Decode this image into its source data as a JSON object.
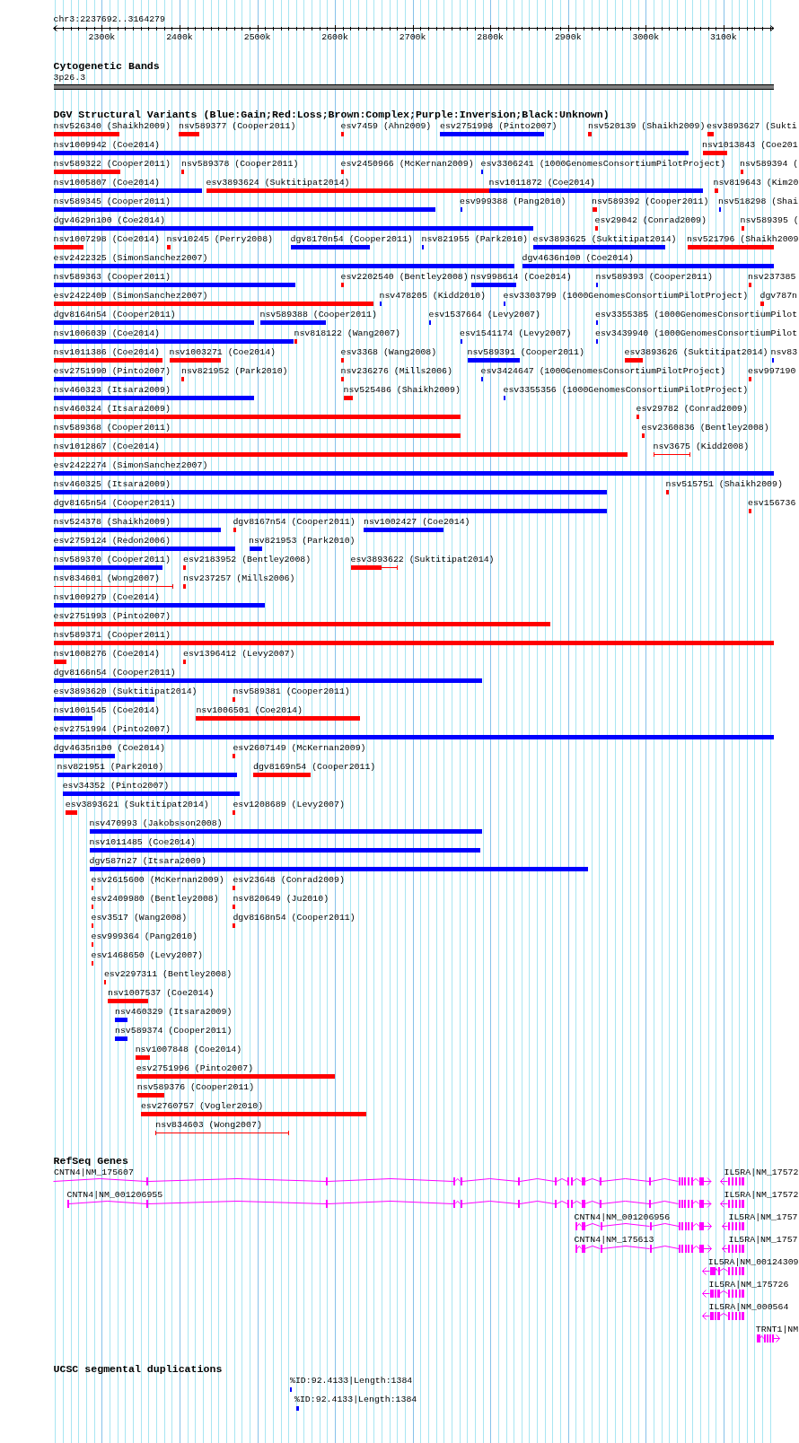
{
  "ruler": {
    "location": "chr3:2237692..3164279",
    "ticks": [
      "2300k",
      "2400k",
      "2500k",
      "2600k",
      "2700k",
      "2800k",
      "2900k",
      "3000k",
      "3100k"
    ]
  },
  "cytogenetic_bands": {
    "title": "Cytogenetic Bands",
    "band": "3p26.3"
  },
  "dgv_structural_variants": {
    "title": "DGV Structural Variants (Blue:Gain;Red:Loss;Brown:Complex;Purple:Inversion;Black:Unknown)",
    "rows": [
      {
        "variants": [
          {
            "label": "nsv526340 (Shaikh2009)",
            "color": "#ff0000"
          },
          {
            "label": "nsv589377 (Cooper2011)",
            "color": "#ff0000"
          },
          {
            "label": "esv7459 (Ahn2009)",
            "color": "#ff0000"
          },
          {
            "label": "esv2751998 (Pinto2007)",
            "color": "#0000ff"
          },
          {
            "label": "nsv520139 (Shaikh2009)",
            "color": "#ff0000"
          },
          {
            "label": "esv3893627 (Sukti",
            "color": "#ff0000"
          }
        ]
      },
      {
        "variants": [
          {
            "label": "nsv1009942 (Coe2014)",
            "color": "#0000ff"
          },
          {
            "label": "nsv1013843 (Coe201",
            "color": "#ff0000"
          }
        ]
      },
      {
        "variants": [
          {
            "label": "nsv589322 (Cooper2011)",
            "color": "#ff0000"
          },
          {
            "label": "nsv589378 (Cooper2011)",
            "color": "#ff0000"
          },
          {
            "label": "esv2450966 (McKernan2009)",
            "color": "#ff0000"
          },
          {
            "label": "esv3306241 (1000GenomesConsortiumPilotProject)",
            "color": "#0000ff"
          },
          {
            "label": "nsv589394 (",
            "color": "#ff0000"
          }
        ]
      },
      {
        "variants": [
          {
            "label": "nsv1005807 (Coe2014)",
            "color": "#0000ff"
          },
          {
            "label": "esv3893624 (Suktitipat2014)",
            "color": "#ff0000"
          },
          {
            "label": "nsv1011872 (Coe2014)",
            "color": "#0000ff"
          },
          {
            "label": "nsv819643 (Kim20",
            "color": "#ff0000"
          }
        ]
      },
      {
        "variants": [
          {
            "label": "nsv589345 (Cooper2011)",
            "color": "#0000ff"
          },
          {
            "label": "esv999388 (Pang2010)",
            "color": "#0000ff"
          },
          {
            "label": "nsv589392 (Cooper2011)",
            "color": "#ff0000"
          },
          {
            "label": "nsv518298 (Shai",
            "color": "#0000ff"
          }
        ]
      },
      {
        "variants": [
          {
            "label": "dgv4629n100 (Coe2014)",
            "color": "#0000ff"
          },
          {
            "label": "esv29042 (Conrad2009)",
            "color": "#ff0000"
          },
          {
            "label": "nsv589395 (",
            "color": "#ff0000"
          }
        ]
      },
      {
        "variants": [
          {
            "label": "nsv1007298 (Coe2014)",
            "color": "#ff0000"
          },
          {
            "label": "nsv10245 (Perry2008)",
            "color": "#ff0000"
          },
          {
            "label": "dgv8170n54 (Cooper2011)",
            "color": "#0000ff"
          },
          {
            "label": "nsv821955 (Park2010)",
            "color": "#0000ff"
          },
          {
            "label": "esv3893625 (Suktitipat2014)",
            "color": "#0000ff"
          },
          {
            "label": "nsv521796 (Shaikh2009",
            "color": "#ff0000"
          }
        ]
      },
      {
        "variants": [
          {
            "label": "esv2422325 (SimonSanchez2007)",
            "color": "#0000ff"
          },
          {
            "label": "dgv4636n100 (Coe2014)",
            "color": "#0000ff"
          }
        ]
      },
      {
        "variants": [
          {
            "label": "nsv589363 (Cooper2011)",
            "color": "#0000ff"
          },
          {
            "label": "esv2202540 (Bentley2008)",
            "color": "#ff0000"
          },
          {
            "label": "nsv998614 (Coe2014)",
            "color": "#0000ff"
          },
          {
            "label": "nsv589393 (Cooper2011)",
            "color": "#0000ff"
          },
          {
            "label": "nsv237385",
            "color": "#ff0000"
          }
        ]
      },
      {
        "variants": [
          {
            "label": "esv2422409 (SimonSanchez2007)",
            "color": "#ff0000"
          },
          {
            "label": "nsv478205 (Kidd2010)",
            "color": "#0000ff"
          },
          {
            "label": "esv3303799 (1000GenomesConsortiumPilotProject)",
            "color": "#0000ff"
          },
          {
            "label": "dgv787n",
            "color": "#ff0000"
          }
        ]
      },
      {
        "variants": [
          {
            "label": "dgv8164n54 (Cooper2011)",
            "color": "#0000ff"
          },
          {
            "label": "nsv589388 (Cooper2011)",
            "color": "#0000ff"
          },
          {
            "label": "esv1537664 (Levy2007)",
            "color": "#0000ff"
          },
          {
            "label": "esv3355385 (1000GenomesConsortiumPilot",
            "color": "#0000ff"
          }
        ]
      },
      {
        "variants": [
          {
            "label": "nsv1006039 (Coe2014)",
            "color": "#0000ff"
          },
          {
            "label": "nsv818122 (Wang2007)",
            "color": "#ff0000"
          },
          {
            "label": "esv1541174 (Levy2007)",
            "color": "#0000ff"
          },
          {
            "label": "esv3439940 (1000GenomesConsortiumPilot",
            "color": "#0000ff"
          }
        ]
      },
      {
        "variants": [
          {
            "label": "nsv1011386 (Coe2014)",
            "color": "#ff0000"
          },
          {
            "label": "nsv1003271 (Coe2014)",
            "color": "#ff0000"
          },
          {
            "label": "esv3368 (Wang2008)",
            "color": "#ff0000"
          },
          {
            "label": "nsv589391 (Cooper2011)",
            "color": "#0000ff"
          },
          {
            "label": "esv3893626 (Suktitipat2014)",
            "color": "#ff0000"
          },
          {
            "label": "nsv83",
            "color": "#0000ff"
          }
        ]
      },
      {
        "variants": [
          {
            "label": "esv2751990 (Pinto2007)",
            "color": "#0000ff"
          },
          {
            "label": "nsv821952 (Park2010)",
            "color": "#ff0000"
          },
          {
            "label": "nsv236276 (Mills2006)",
            "color": "#ff0000"
          },
          {
            "label": "esv3424647 (1000GenomesConsortiumPilotProject)",
            "color": "#0000ff"
          },
          {
            "label": "esv997190",
            "color": "#ff0000"
          }
        ]
      },
      {
        "variants": [
          {
            "label": "nsv460323 (Itsara2009)",
            "color": "#0000ff"
          },
          {
            "label": "nsv525486 (Shaikh2009)",
            "color": "#ff0000"
          },
          {
            "label": "esv3355356 (1000GenomesConsortiumPilotProject)",
            "color": "#0000ff"
          }
        ]
      },
      {
        "variants": [
          {
            "label": "nsv460324 (Itsara2009)",
            "color": "#ff0000"
          },
          {
            "label": "esv29782 (Conrad2009)",
            "color": "#ff0000"
          }
        ]
      },
      {
        "variants": [
          {
            "label": "nsv589368 (Cooper2011)",
            "color": "#ff0000"
          },
          {
            "label": "esv2360836 (Bentley2008)",
            "color": "#ff0000"
          }
        ]
      },
      {
        "variants": [
          {
            "label": "nsv1012867 (Coe2014)",
            "color": "#ff0000"
          },
          {
            "label": "nsv3675 (Kidd2008)",
            "color": "#ff0000"
          }
        ]
      },
      {
        "variants": [
          {
            "label": "esv2422274 (SimonSanchez2007)",
            "color": "#0000ff"
          }
        ]
      },
      {
        "variants": [
          {
            "label": "nsv460325 (Itsara2009)",
            "color": "#0000ff"
          },
          {
            "label": "nsv515751 (Shaikh2009)",
            "color": "#ff0000"
          }
        ]
      },
      {
        "variants": [
          {
            "label": "dgv8165n54 (Cooper2011)",
            "color": "#0000ff"
          },
          {
            "label": "esv156736",
            "color": "#ff0000"
          }
        ]
      },
      {
        "variants": [
          {
            "label": "nsv524378 (Shaikh2009)",
            "color": "#0000ff"
          },
          {
            "label": "dgv8167n54 (Cooper2011)",
            "color": "#ff0000"
          },
          {
            "label": "nsv1002427 (Coe2014)",
            "color": "#0000ff"
          }
        ]
      },
      {
        "variants": [
          {
            "label": "esv2759124 (Redon2006)",
            "color": "#0000ff"
          },
          {
            "label": "nsv821953 (Park2010)",
            "color": "#0000ff"
          }
        ]
      },
      {
        "variants": [
          {
            "label": "nsv589370 (Cooper2011)",
            "color": "#0000ff"
          },
          {
            "label": "esv2183952 (Bentley2008)",
            "color": "#ff0000"
          },
          {
            "label": "esv3893622 (Suktitipat2014)",
            "color": "#ff0000"
          }
        ]
      },
      {
        "variants": [
          {
            "label": "nsv834601 (Wong2007)",
            "color": "#ff0000"
          },
          {
            "label": "nsv237257 (Mills2006)",
            "color": "#ff0000"
          }
        ]
      },
      {
        "variants": [
          {
            "label": "nsv1009279 (Coe2014)",
            "color": "#0000ff"
          }
        ]
      },
      {
        "variants": [
          {
            "label": "esv2751993 (Pinto2007)",
            "color": "#ff0000"
          }
        ]
      },
      {
        "variants": [
          {
            "label": "nsv589371 (Cooper2011)",
            "color": "#ff0000"
          }
        ]
      },
      {
        "variants": [
          {
            "label": "nsv1008276 (Coe2014)",
            "color": "#ff0000"
          },
          {
            "label": "esv1396412 (Levy2007)",
            "color": "#ff0000"
          }
        ]
      },
      {
        "variants": [
          {
            "label": "dgv8166n54 (Cooper2011)",
            "color": "#0000ff"
          }
        ]
      },
      {
        "variants": [
          {
            "label": "esv3893620 (Suktitipat2014)",
            "color": "#0000ff"
          },
          {
            "label": "nsv589381 (Cooper2011)",
            "color": "#ff0000"
          }
        ]
      },
      {
        "variants": [
          {
            "label": "nsv1001545 (Coe2014)",
            "color": "#0000ff"
          },
          {
            "label": "nsv1006501 (Coe2014)",
            "color": "#ff0000"
          }
        ]
      },
      {
        "variants": [
          {
            "label": "esv2751994 (Pinto2007)",
            "color": "#0000ff"
          }
        ]
      },
      {
        "variants": [
          {
            "label": "dgv4635n100 (Coe2014)",
            "color": "#0000ff"
          },
          {
            "label": "esv2607149 (McKernan2009)",
            "color": "#ff0000"
          }
        ]
      },
      {
        "variants": [
          {
            "label": "nsv821951 (Park2010)",
            "color": "#0000ff"
          },
          {
            "label": "dgv8169n54 (Cooper2011)",
            "color": "#ff0000"
          }
        ]
      },
      {
        "variants": [
          {
            "label": "esv34352 (Pinto2007)",
            "color": "#0000ff"
          }
        ]
      },
      {
        "variants": [
          {
            "label": "esv3893621 (Suktitipat2014)",
            "color": "#ff0000"
          },
          {
            "label": "esv1208689 (Levy2007)",
            "color": "#ff0000"
          }
        ]
      },
      {
        "variants": [
          {
            "label": "nsv470993 (Jakobsson2008)",
            "color": "#0000ff"
          }
        ]
      },
      {
        "variants": [
          {
            "label": "nsv1011485 (Coe2014)",
            "color": "#0000ff"
          }
        ]
      },
      {
        "variants": [
          {
            "label": "dgv587n27 (Itsara2009)",
            "color": "#0000ff"
          }
        ]
      },
      {
        "variants": [
          {
            "label": "esv2615600 (McKernan2009)",
            "color": "#ff0000"
          },
          {
            "label": "esv23648 (Conrad2009)",
            "color": "#ff0000"
          }
        ]
      },
      {
        "variants": [
          {
            "label": "esv2409980 (Bentley2008)",
            "color": "#ff0000"
          },
          {
            "label": "nsv820649 (Ju2010)",
            "color": "#ff0000"
          }
        ]
      },
      {
        "variants": [
          {
            "label": "esv3517 (Wang2008)",
            "color": "#ff0000"
          },
          {
            "label": "dgv8168n54 (Cooper2011)",
            "color": "#ff0000"
          }
        ]
      },
      {
        "variants": [
          {
            "label": "esv999364 (Pang2010)",
            "color": "#ff0000"
          }
        ]
      },
      {
        "variants": [
          {
            "label": "esv1468650 (Levy2007)",
            "color": "#ff0000"
          }
        ]
      },
      {
        "variants": [
          {
            "label": "esv2297311 (Bentley2008)",
            "color": "#ff0000"
          }
        ]
      },
      {
        "variants": [
          {
            "label": "nsv1007537 (Coe2014)",
            "color": "#ff0000"
          }
        ]
      },
      {
        "variants": [
          {
            "label": "nsv460329 (Itsara2009)",
            "color": "#0000ff"
          }
        ]
      },
      {
        "variants": [
          {
            "label": "nsv589374 (Cooper2011)",
            "color": "#0000ff"
          }
        ]
      },
      {
        "variants": [
          {
            "label": "nsv1007848 (Coe2014)",
            "color": "#ff0000"
          }
        ]
      },
      {
        "variants": [
          {
            "label": "esv2751996 (Pinto2007)",
            "color": "#ff0000"
          }
        ]
      },
      {
        "variants": [
          {
            "label": "nsv589376 (Cooper2011)",
            "color": "#ff0000"
          }
        ]
      },
      {
        "variants": [
          {
            "label": "esv2760757 (Vogler2010)",
            "color": "#ff0000"
          }
        ]
      },
      {
        "variants": [
          {
            "label": "nsv834603 (Wong2007)",
            "color": "#ff0000"
          }
        ]
      }
    ]
  },
  "refseq_genes": {
    "title": "RefSeq Genes",
    "rows": [
      {
        "genes": [
          {
            "label": "CNTN4|NM_175607"
          },
          {
            "label": "IL5RA|NM_17572"
          }
        ]
      },
      {
        "genes": [
          {
            "label": "CNTN4|NM_001206955"
          },
          {
            "label": "IL5RA|NM_17572"
          }
        ]
      },
      {
        "genes": [
          {
            "label": "CNTN4|NM_001206956"
          },
          {
            "label": "IL5RA|NM_1757"
          }
        ]
      },
      {
        "genes": [
          {
            "label": "CNTN4|NM_175613"
          },
          {
            "label": "IL5RA|NM_1757"
          }
        ]
      },
      {
        "genes": [
          {
            "label": "IL5RA|NM_00124309"
          }
        ]
      },
      {
        "genes": [
          {
            "label": "IL5RA|NM_175726"
          }
        ]
      },
      {
        "genes": [
          {
            "label": "IL5RA|NM_000564"
          }
        ]
      },
      {
        "genes": [
          {
            "label": "TRNT1|NM"
          }
        ]
      }
    ]
  },
  "ucsc_segmental_duplications": {
    "title": "UCSC segmental duplications",
    "features": [
      {
        "label": "%ID:92.4133|Length:1384"
      },
      {
        "label": "%ID:92.4133|Length:1384"
      }
    ]
  }
}
